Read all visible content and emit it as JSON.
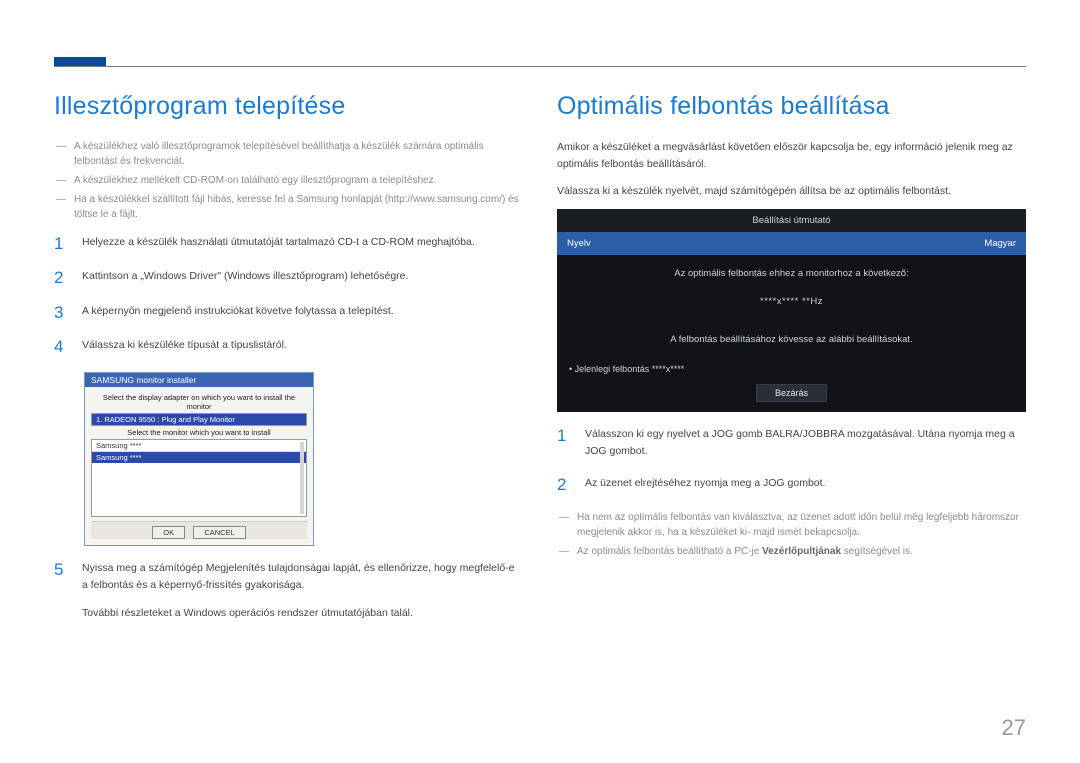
{
  "page_number": "27",
  "left": {
    "heading": "Illesztőprogram telepítése",
    "notes": [
      "A készülékhez való illesztőprogramok telepítésével beállíthatja a készülék számára optimális felbontást és frekvenciát.",
      "A készülékhez mellékelt CD-ROM-on található egy illesztőprogram a telepítéshez.",
      "Ha a készülékkel szállított fájl hibás, keresse fel a Samsung honlapját (http://www.samsung.com/) és töltse le a fájlt."
    ],
    "steps": [
      "Helyezze a készülék használati útmutatóját tartalmazó CD-t a CD-ROM meghajtóba.",
      "Kattintson a „Windows Driver\" (Windows illesztőprogram) lehetőségre.",
      "A képernyőn megjelenő instrukciókat követve folytassa a telepítést.",
      "Válassza ki készüléke típusát a típuslistáról."
    ],
    "step5": "Nyissa meg a számítógép Megjelenítés tulajdonságai lapját, és ellenőrizze, hogy megfelelő-e a felbontás és a képernyő-frissítés gyakorisága.",
    "step5_extra": "További részleteket a Windows operációs rendszer útmutatójában talál.",
    "installer": {
      "title": "SAMSUNG monitor installer",
      "prompt1": "Select the display adapter on which you want to install the monitor",
      "adapter": "1. RADEON 9550 : Plug and Play Monitor",
      "prompt2": "Select the monitor which you want to install",
      "rows": [
        "Samsung ****",
        "Samsung ****"
      ],
      "ok": "OK",
      "cancel": "CANCEL"
    }
  },
  "right": {
    "heading": "Optimális felbontás beállítása",
    "intro1": "Amikor a készüléket a megvásárlást követően először kapcsolja be, egy információ jelenik meg az optimális felbontás beállításáról.",
    "intro2": "Válassza ki a készülék nyelvét, majd számítógépén állítsa be az optimális felbontást.",
    "osd": {
      "title": "Beállítási útmutató",
      "lang_label": "Nyelv",
      "lang_value": "Magyar",
      "line1": "Az optimális felbontás ehhez a monitorhoz a következő:",
      "blank": "****x**** **Hz",
      "line2": "A felbontás beállításához kövesse az alábbi beállításokat.",
      "current": "• Jelenlegi felbontás   ****x****",
      "close": "Bezárás"
    },
    "steps": [
      "Válasszon ki egy nyelvet a JOG gomb BALRA/JOBBRA mozgatásával. Utána nyomja meg a JOG gombot.",
      "Az üzenet elrejtéséhez nyomja meg a JOG gombot."
    ],
    "notes_after": [
      "Ha nem az optimális felbontás van kiválasztva, az üzenet adott időn belül még legfeljebb háromszor megjelenik akkor is, ha a készüléket ki- majd ismét bekapcsolja."
    ],
    "note_with_bold_pre": "Az optimális felbontás beállítható a PC-je ",
    "note_with_bold_bold": "Vezérlőpultjának",
    "note_with_bold_post": " segítségével is."
  }
}
